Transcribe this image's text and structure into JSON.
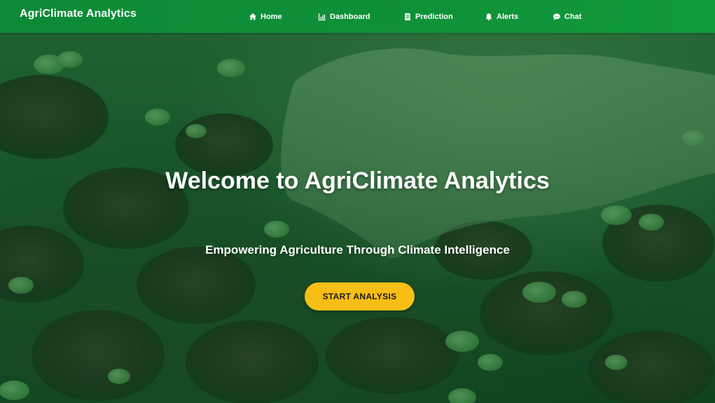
{
  "app": {
    "brand": "AgriClimate Analytics"
  },
  "nav": {
    "items": [
      {
        "label": "Home",
        "icon": "home-icon"
      },
      {
        "label": "Dashboard",
        "icon": "chart-icon"
      },
      {
        "label": "Prediction",
        "icon": "document-icon"
      },
      {
        "label": "Alerts",
        "icon": "bell-icon"
      },
      {
        "label": "Chat",
        "icon": "chat-bubble-icon"
      }
    ]
  },
  "hero": {
    "title": "Welcome to AgriClimate Analytics",
    "subtitle": "Empowering Agriculture Through Climate Intelligence",
    "cta_label": "START ANALYSIS",
    "background_image": "hand-planting-seedlings-in-pots"
  },
  "colors": {
    "navbar": "#0f9138",
    "cta": "#f7be16",
    "overlay": "#0a501e"
  }
}
